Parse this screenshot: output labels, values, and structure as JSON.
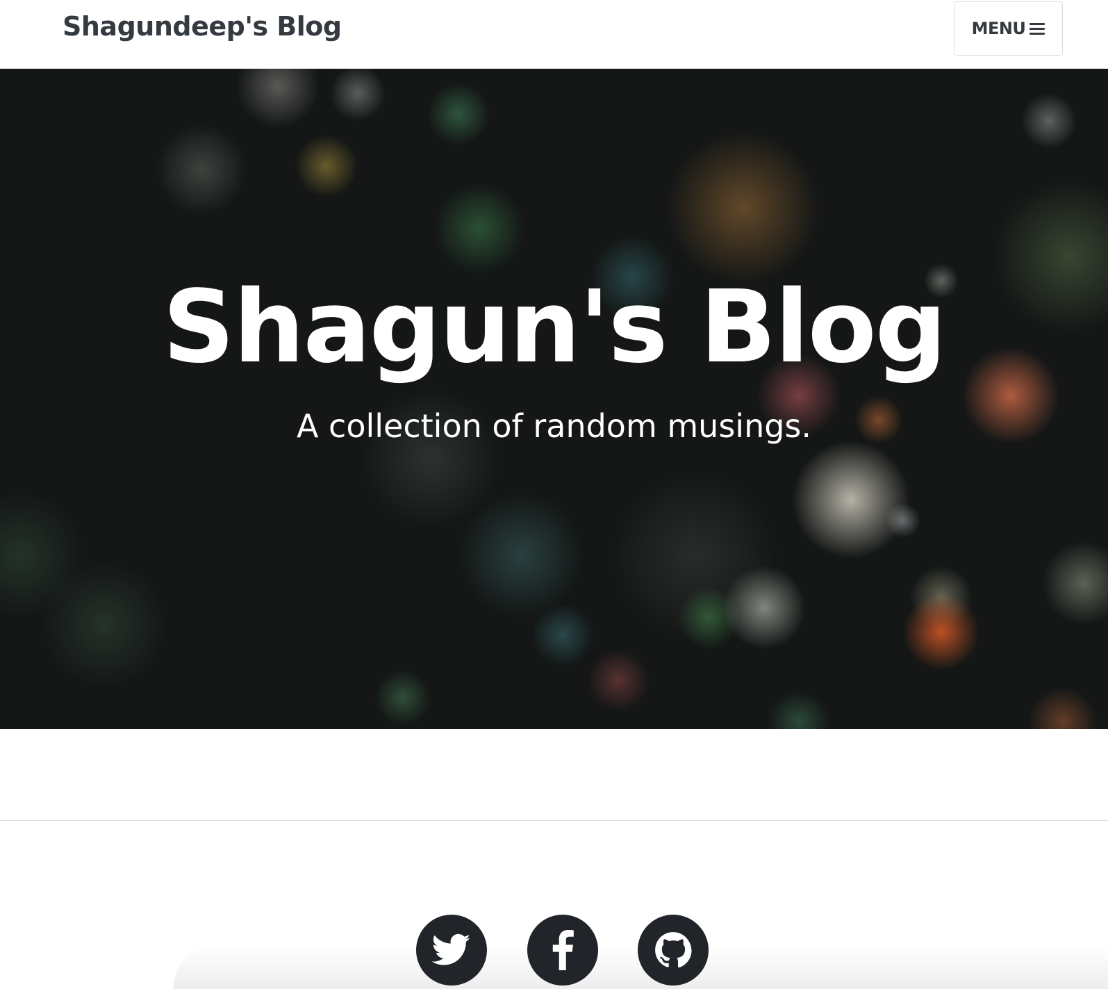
{
  "navbar": {
    "brand": "Shagundeep's Blog",
    "menu_label": "MENU",
    "menu_icon": "bars-icon"
  },
  "hero": {
    "title": "Shagun's Blog",
    "subtitle": "A collection of random musings."
  },
  "footer": {
    "social_links": [
      {
        "name": "Twitter",
        "icon": "twitter-icon"
      },
      {
        "name": "Facebook",
        "icon": "facebook-icon"
      },
      {
        "name": "GitHub",
        "icon": "github-icon"
      }
    ]
  },
  "colors": {
    "text_dark": "#343a40",
    "social_bg": "#212529",
    "hero_text": "#ffffff"
  }
}
